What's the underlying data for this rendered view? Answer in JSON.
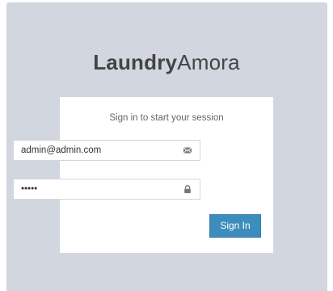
{
  "logo": {
    "bold": "Laundry",
    "light": "Amora"
  },
  "login": {
    "message": "Sign in to start your session",
    "email": {
      "value": "admin@admin.com",
      "icon": "envelope-icon"
    },
    "password": {
      "value": "admin",
      "icon": "lock-icon"
    },
    "submit_label": "Sign In"
  },
  "colors": {
    "background": "#d2d6de",
    "accent": "#3c8dbc",
    "logo_text": "#444444"
  }
}
